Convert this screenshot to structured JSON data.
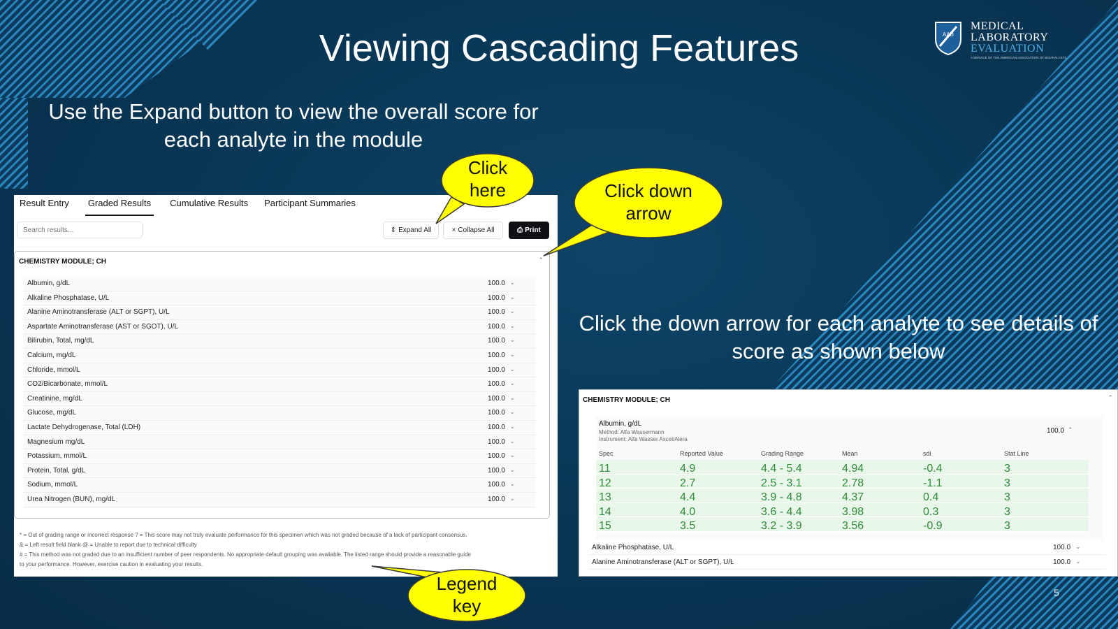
{
  "slide": {
    "title": "Viewing Cascading Features",
    "caption_left": "Use the Expand button to view the overall score for each analyte in the module",
    "caption_right": "Click the down arrow for each analyte to see details of score as shown below",
    "page_number": "5"
  },
  "logo": {
    "line1": "MEDICAL",
    "line2": "LABORATORY",
    "line3": "EVALUATION",
    "tagline": "A SERVICE OF THE AMERICAN ASSOCIATION OF BIOANALYSTS",
    "badge": "AAB"
  },
  "callouts": {
    "click_here": [
      "Click",
      "here"
    ],
    "click_down": [
      "Click down",
      "arrow"
    ],
    "legend_key": [
      "Legend",
      "key"
    ]
  },
  "colors": {
    "background": "#0b3a5c",
    "stripe": "#2a86bd",
    "callout_fill": "#ffff00",
    "pass_green": "#2f8a3a",
    "pass_row": "#e9f7ea"
  },
  "app": {
    "tabs": [
      "Result Entry",
      "Graded Results",
      "Cumulative Results",
      "Participant Summaries"
    ],
    "active_tab": "Graded Results",
    "search_placeholder": "Search results...",
    "expand_all": "Expand All",
    "collapse_all": "Collapse All",
    "print": "Print",
    "module_title": "CHEMISTRY MODULE; CH",
    "analytes": [
      {
        "name": "Albumin, g/dL",
        "score": "100.0"
      },
      {
        "name": "Alkaline Phosphatase, U/L",
        "score": "100.0"
      },
      {
        "name": "Alanine Aminotransferase (ALT or SGPT), U/L",
        "score": "100.0"
      },
      {
        "name": "Aspartate Aminotransferase (AST or SGOT), U/L",
        "score": "100.0"
      },
      {
        "name": "Bilirubin, Total, mg/dL",
        "score": "100.0"
      },
      {
        "name": "Calcium, mg/dL",
        "score": "100.0"
      },
      {
        "name": "Chloride, mmol/L",
        "score": "100.0"
      },
      {
        "name": "CO2/Bicarbonate, mmol/L",
        "score": "100.0"
      },
      {
        "name": "Creatinine, mg/dL",
        "score": "100.0"
      },
      {
        "name": "Glucose, mg/dL",
        "score": "100.0"
      },
      {
        "name": "Lactate Dehydrogenase, Total (LDH)",
        "score": "100.0"
      },
      {
        "name": "Magnesium mg/dL",
        "score": "100.0"
      },
      {
        "name": "Potassium, mmol/L",
        "score": "100.0"
      },
      {
        "name": "Protein, Total, g/dL",
        "score": "100.0"
      },
      {
        "name": "Sodium, mmol/L",
        "score": "100.0"
      },
      {
        "name": "Urea Nitrogen (BUN), mg/dL",
        "score": "100.0"
      }
    ],
    "legend": [
      "* = Out of grading range or incorrect response ? = This score may not truly evaluate performance for this specimen which was not graded because of a lack of participant consensus.",
      "& = Left result field blank @ = Unable to report due to technical difficulty",
      "# = This method was not graded due to an insufficient number of peer respondents. No appropriate default grouping was available. The listed range should provide a reasonable guide",
      "to your performance. However, exercise caution in evaluating your results."
    ]
  },
  "detail": {
    "module_title": "CHEMISTRY MODULE; CH",
    "analyte_name": "Albumin, g/dL",
    "method": "Method: Alfa Wassermann",
    "instrument": "Instrument: Alfa Wasser Axcel/Alera",
    "score": "100.0",
    "columns": [
      "Spec",
      "Reported Value",
      "Grading Range",
      "Mean",
      "sdi",
      "Stat Line"
    ],
    "rows": [
      [
        "11",
        "4.9",
        "4.4 - 5.4",
        "4.94",
        "-0.4",
        "3"
      ],
      [
        "12",
        "2.7",
        "2.5 - 3.1",
        "2.78",
        "-1.1",
        "3"
      ],
      [
        "13",
        "4.4",
        "3.9 - 4.8",
        "4.37",
        "0.4",
        "3"
      ],
      [
        "14",
        "4.0",
        "3.6 - 4.4",
        "3.98",
        "0.3",
        "3"
      ],
      [
        "15",
        "3.5",
        "3.2 - 3.9",
        "3.56",
        "-0.9",
        "3"
      ]
    ],
    "more_analytes": [
      {
        "name": "Alkaline Phosphatase, U/L",
        "score": "100.0"
      },
      {
        "name": "Alanine Aminotransferase (ALT or SGPT), U/L",
        "score": "100.0"
      }
    ]
  }
}
